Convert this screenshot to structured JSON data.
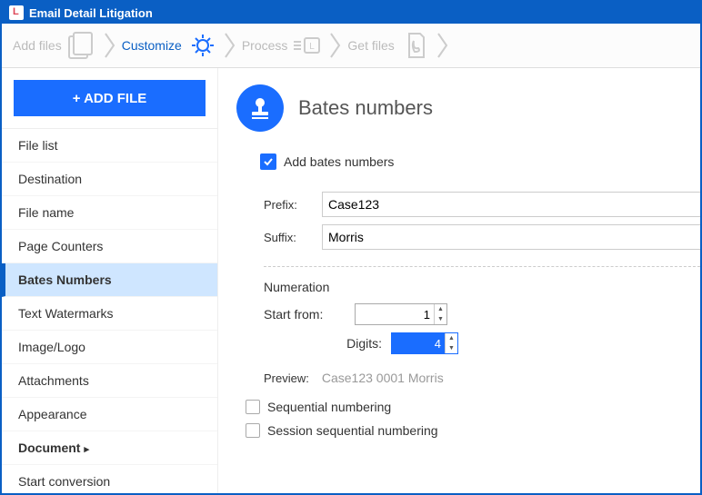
{
  "window": {
    "title": "Email Detail Litigation"
  },
  "stepbar": {
    "steps": [
      {
        "label": "Add files",
        "current": false
      },
      {
        "label": "Customize",
        "current": true
      },
      {
        "label": "Process",
        "current": false
      },
      {
        "label": "Get files",
        "current": false
      }
    ]
  },
  "sidebar": {
    "add_file": "+ ADD FILE",
    "items": [
      {
        "label": "File list"
      },
      {
        "label": "Destination"
      },
      {
        "label": "File name"
      },
      {
        "label": "Page Counters"
      },
      {
        "label": "Bates Numbers",
        "active": true
      },
      {
        "label": "Text Watermarks"
      },
      {
        "label": "Image/Logo"
      },
      {
        "label": "Attachments"
      },
      {
        "label": "Appearance"
      },
      {
        "label": "Document",
        "expando": true
      },
      {
        "label": "Start conversion"
      }
    ]
  },
  "main": {
    "title": "Bates numbers",
    "add_bates_label": "Add bates numbers",
    "add_bates_checked": true,
    "prefix_label": "Prefix:",
    "prefix_value": "Case123",
    "suffix_label": "Suffix:",
    "suffix_value": "Morris",
    "numeration_title": "Numeration",
    "start_from_label": "Start from:",
    "start_from_value": "1",
    "digits_label": "Digits:",
    "digits_value": "4",
    "preview_label": "Preview:",
    "preview_value": "Case123 0001 Morris",
    "sequential_label": "Sequential numbering",
    "session_label": "Session sequential numbering"
  }
}
